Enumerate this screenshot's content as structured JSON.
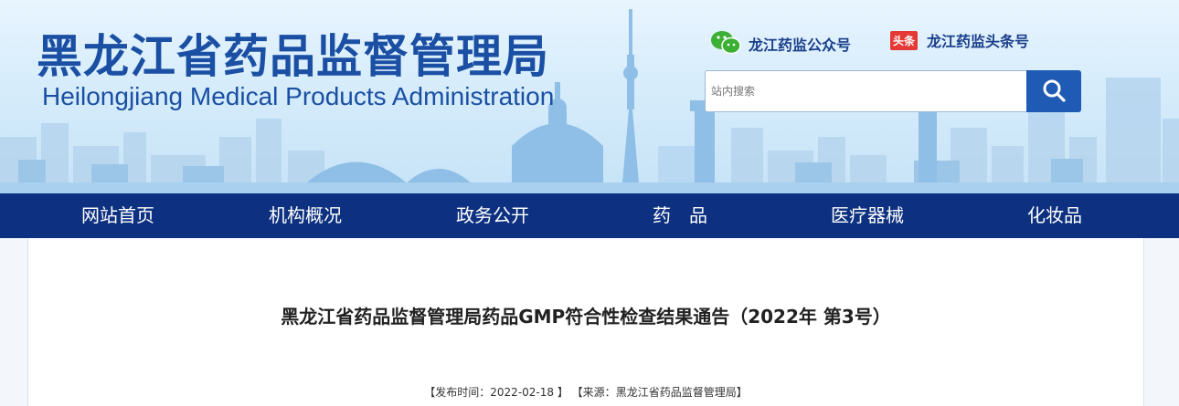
{
  "header": {
    "title": "黑龙江省药品监督管理局",
    "subtitle": "Heilongjiang Medical Products Administration",
    "wechat_label": "龙江药监公众号",
    "toutiao_badge": "头条",
    "toutiao_label": "龙江药监头条号"
  },
  "search": {
    "placeholder": "站内搜索",
    "icon": "search-icon"
  },
  "nav": {
    "items": [
      {
        "label": "网站首页"
      },
      {
        "label": "机构概况"
      },
      {
        "label": "政务公开"
      },
      {
        "label": "药　品"
      },
      {
        "label": "医疗器械"
      },
      {
        "label": "化妆品"
      }
    ]
  },
  "article": {
    "title": "黑龙江省药品监督管理局药品GMP符合性检查结果通告（2022年 第3号）",
    "publish_prefix": "【发布时间：",
    "publish_date": "2022-02-18",
    "publish_suffix": " 】 ",
    "source_prefix": "【来源：",
    "source": "黑龙江省药品监督管理局",
    "source_suffix": "】"
  },
  "colors": {
    "nav_bg": "#0d3180",
    "brand_blue": "#1a4fa3",
    "search_button": "#1f5bb5",
    "wechat_green": "#3cb034",
    "toutiao_red": "#e53935"
  }
}
